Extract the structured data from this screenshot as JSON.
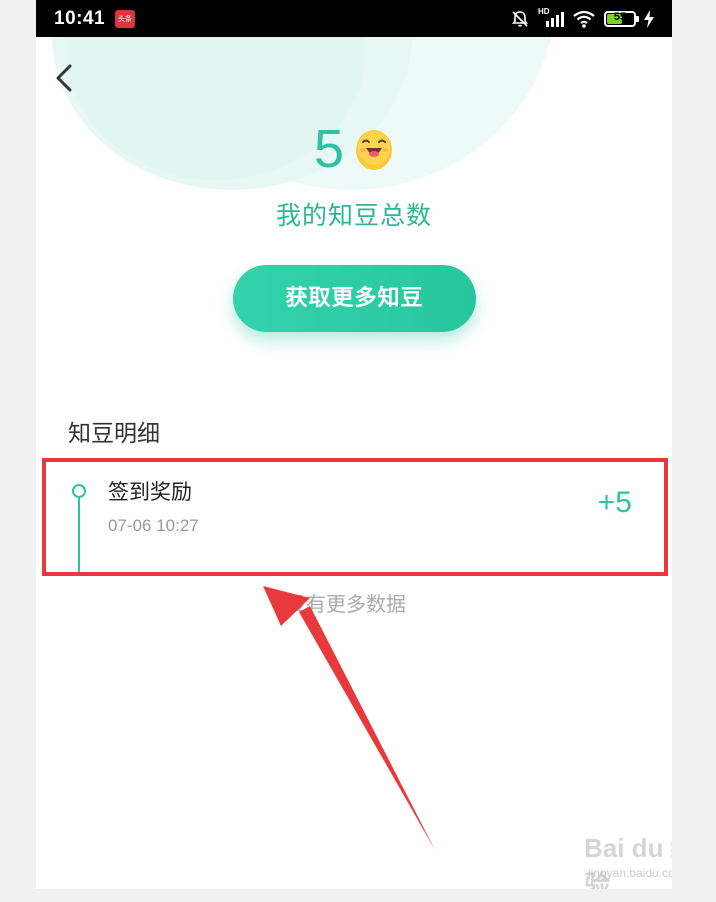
{
  "status_bar": {
    "time": "10:41",
    "app_badge": "头条",
    "network": "HD",
    "battery": "55"
  },
  "header": {
    "total_value": "5",
    "total_label": "我的知豆总数",
    "get_more_button": "获取更多知豆"
  },
  "details": {
    "title": "知豆明细",
    "records": [
      {
        "title": "签到奖励",
        "time": "07-06 10:27",
        "amount": "+5"
      }
    ],
    "no_more": "没有更多数据"
  },
  "watermark": {
    "brand": "Bai du 经验",
    "url": "jingyan.baidu.com"
  },
  "colors": {
    "accent": "#2cc3a0",
    "highlight": "#e8393d"
  }
}
